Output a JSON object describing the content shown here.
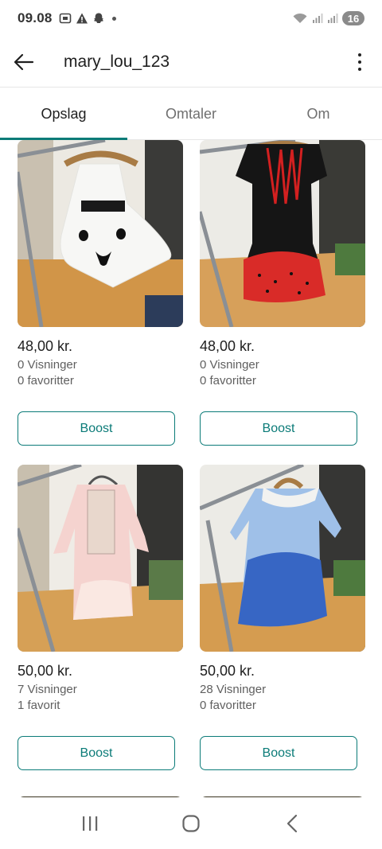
{
  "status": {
    "time": "09.08",
    "battery": "16"
  },
  "app_bar": {
    "title": "mary_lou_123"
  },
  "tabs": [
    {
      "label": "Opslag"
    },
    {
      "label": "Omtaler"
    },
    {
      "label": "Om"
    }
  ],
  "listings": [
    {
      "price": "48,00 kr.",
      "views": "0 Visninger",
      "favorites": "0 favoritter",
      "boost_label": "Boost",
      "dress_color": "#f4f4f4"
    },
    {
      "price": "48,00 kr.",
      "views": "0 Visninger",
      "favorites": "0 favoritter",
      "boost_label": "Boost",
      "dress_color": "#1a1a1a"
    },
    {
      "price": "50,00 kr.",
      "views": "7 Visninger",
      "favorites": "1 favorit",
      "boost_label": "Boost",
      "dress_color": "#f6d6d2"
    },
    {
      "price": "50,00 kr.",
      "views": "28 Visninger",
      "favorites": "0 favoritter",
      "boost_label": "Boost",
      "dress_color": "#3b6fcf"
    }
  ],
  "colors": {
    "accent": "#0b7b78",
    "floor": "#d49a4a",
    "wall": "#f3f1ec"
  }
}
